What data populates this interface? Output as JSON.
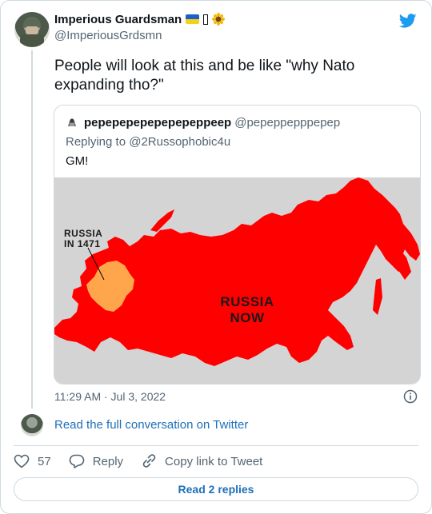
{
  "author": {
    "display_name": "Imperious Guardsman",
    "handle": "@ImperiousGrdsmn",
    "emoji": [
      "ukraine-flag-icon",
      "unknown-glyph-icon",
      "sunflower-icon"
    ]
  },
  "tweet": {
    "text": "People will look at this and be like \"why Nato expanding tho?\"",
    "timestamp": "11:29 AM · Jul 3, 2022"
  },
  "quoted_tweet": {
    "display_name": "pepepepepepepepeppeep",
    "handle": "@pepeppepppepep",
    "replying_to_prefix": "Replying to",
    "replying_to_handle": "@2Russophobic4u",
    "text": "GM!",
    "image": {
      "label_old_line1": "RUSSIA",
      "label_old_line2": "IN 1471",
      "label_now_line1": "RUSSIA",
      "label_now_line2": "NOW",
      "colors": {
        "background": "#d4d4d4",
        "russia_now": "#ff0000",
        "russia_1471": "#ffa64d"
      }
    }
  },
  "footer": {
    "read_conversation": "Read the full conversation on Twitter",
    "like_count": "57",
    "reply_label": "Reply",
    "copy_link_label": "Copy link to Tweet",
    "read_replies": "Read 2 replies"
  },
  "colors": {
    "accent": "#1d9bf0",
    "link": "#1d6fb8",
    "muted": "#536471",
    "border": "#cfd9de"
  }
}
